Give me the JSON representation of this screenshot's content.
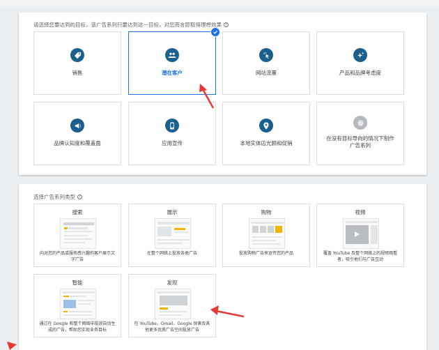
{
  "goals": {
    "title": "请选择您要达到的目标，该广告系列只要达到这一目标，对您而言即取得理想效果",
    "items": [
      {
        "label": "销售",
        "icon": "tag-icon",
        "selected": false
      },
      {
        "label": "潜在客户",
        "icon": "people-icon",
        "selected": true
      },
      {
        "label": "网站流量",
        "icon": "cursor-click-icon",
        "selected": false
      },
      {
        "label": "产品和品牌考虑度",
        "icon": "sparkle-icon",
        "selected": false
      },
      {
        "label": "品牌认知度和覆盖面",
        "icon": "megaphone-icon",
        "selected": false
      },
      {
        "label": "应用宣传",
        "icon": "phone-icon",
        "selected": false
      },
      {
        "label": "本地实体店光顾和促销",
        "icon": "map-pin-icon",
        "selected": false
      },
      {
        "label": "在没有目标导向的情况下制作广告系列",
        "icon": "gear-icon",
        "selected": false
      }
    ]
  },
  "campaign_types": {
    "title": "选择广告系列类型",
    "items": [
      {
        "title": "搜索",
        "desc": "向对您的产品或服务感兴趣的客户展示文字广告"
      },
      {
        "title": "展示",
        "desc": "在整个网络上投放各类广告"
      },
      {
        "title": "购物",
        "desc": "投放购物广告来宣传您的产品"
      },
      {
        "title": "视频",
        "desc": "覆盖 YouTube 及整个网络上的视频观看者，吸引他们与广告互动"
      },
      {
        "title": "智能",
        "desc": "通过在 Google 和整个网络中投放自动生成的广告，帮助您实现业务目标"
      },
      {
        "title": "发现",
        "desc": "在 YouTube、Gmail、Google 探索及其他更多优质广告空间投放广告"
      }
    ]
  },
  "colors": {
    "accent": "#1a73e8",
    "icon_circle": "#1a5f8e",
    "arrow": "#e53935"
  }
}
